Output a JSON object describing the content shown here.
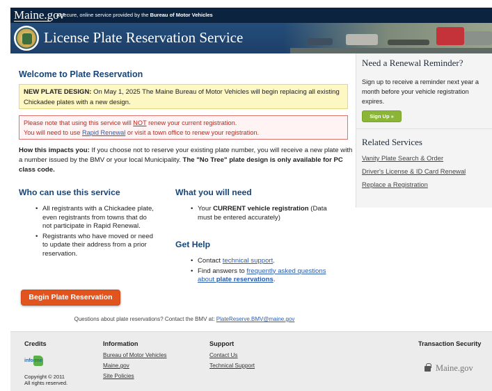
{
  "header": {
    "logo_text": "Maine.gov",
    "tagline_prefix": "A secure, online service provided by the",
    "tagline_agency": "Bureau of Motor Vehicles",
    "title": "License Plate Reservation Service"
  },
  "main": {
    "heading": "Welcome to Plate Reservation",
    "notice_label": "NEW PLATE DESIGN:",
    "notice_text": "On May 1, 2025 The Maine Bureau of Motor Vehicles will begin replacing all existing Chickadee plates with a new design.",
    "warning_line1_a": "Please note that using this service will",
    "warning_line1_not": "NOT",
    "warning_line1_b": "renew your current registration.",
    "warning_line2_a": "You will need to use",
    "warning_link": "Rapid Renewal",
    "warning_line2_b": "or visit a town office to renew your registration.",
    "impacts_label": "How this impacts you:",
    "impacts_text": "If you choose not to reserve your existing plate number, you will receive a new plate with a number issued by the BMV or your local Municipality.",
    "impacts_bold": "The \"No Tree\" plate design is only available for PC class code.",
    "who_heading": "Who can use this service",
    "who_items": [
      "All registrants with a Chickadee plate, even registrants from towns that do not participate in Rapid Renewal.",
      "Registrants who have moved or need to update their address from a prior reservation."
    ],
    "need_heading": "What you will need",
    "need_prefix": "Your",
    "need_bold": "CURRENT vehicle registration",
    "need_suffix": "(Data must be entered accurately)",
    "help_heading": "Get Help",
    "help_item1_prefix": "Contact",
    "help_item1_link": "technical support",
    "help_item1_suffix": ".",
    "help_item2_prefix": "Find answers to",
    "help_item2_link_a": "frequently asked questions about",
    "help_item2_link_b": "plate reservations",
    "help_item2_suffix": ".",
    "begin_button": "Begin Plate Reservation",
    "questions_text": "Questions about plate reservations? Contact the BMV at:",
    "questions_email": "PlateReserve.BMV@maine.gov"
  },
  "sidebar": {
    "reminder_heading": "Need a Renewal Reminder?",
    "reminder_text": "Sign up to receive a reminder next year a month before your vehicle registration expires.",
    "signup_button": "Sign Up »",
    "related_heading": "Related Services",
    "related_links": [
      "Vanity Plate Search & Order",
      "Driver's License & ID Card Renewal",
      "Replace a Registration"
    ]
  },
  "footer": {
    "credits_heading": "Credits",
    "informe_text": "informe",
    "copyright_line1": "Copyright © 2011",
    "copyright_line2": "All rights reserved.",
    "info_heading": "Information",
    "info_links": [
      "Bureau of Motor Vehicles",
      "Maine.gov",
      "Site Policies"
    ],
    "support_heading": "Support",
    "support_links": [
      "Contact Us",
      "Technical Support"
    ],
    "security_heading": "Transaction Security",
    "security_logo": "Maine.gov"
  },
  "colors": {
    "topbar": "#0c2340",
    "banner": "#244d7a",
    "heading_blue": "#17457a",
    "begin_button": "#e2541e",
    "signup_button": "#8ab537",
    "warning_red": "#c0281f",
    "notice_yellow": "#fdf7c3"
  }
}
